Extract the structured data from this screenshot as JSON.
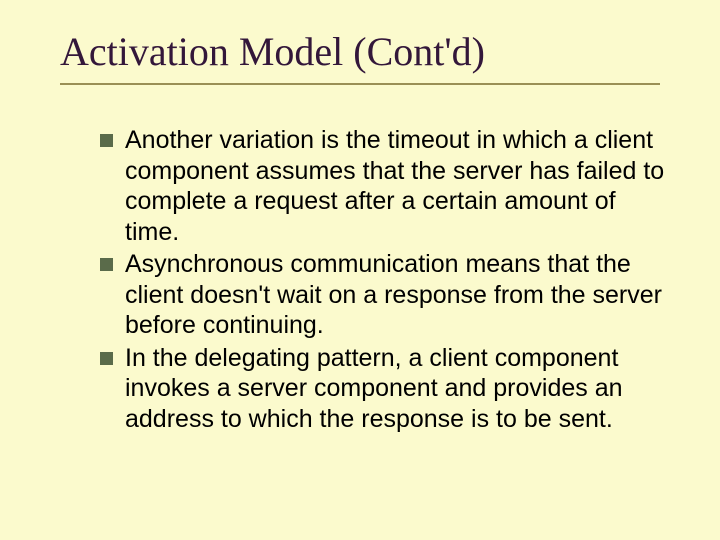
{
  "title": "Activation Model (Cont'd)",
  "bullets": [
    "Another variation is the timeout in which a client component assumes that the server has failed to complete a request after a certain amount of time.",
    "Asynchronous communication means that the client doesn't wait on a response from the server before continuing.",
    "In the delegating pattern, a client component invokes a server component and provides an address to which the response is to be sent."
  ]
}
